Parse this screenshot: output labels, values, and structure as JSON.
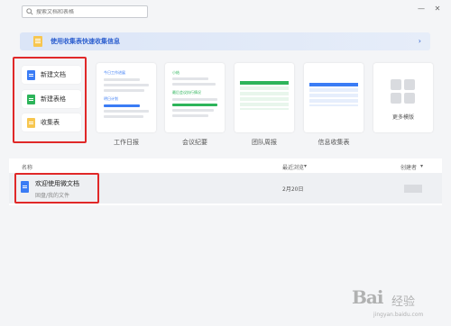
{
  "search": {
    "placeholder": "搜索文档和表格",
    "icon": "search-icon"
  },
  "window": {
    "minimize": "—",
    "close": "✕"
  },
  "banner": {
    "text": "使用收集表快速收集信息",
    "icon": "form-icon",
    "arrow": "›"
  },
  "new_buttons": [
    {
      "label": "新建文档",
      "icon": "doc-icon",
      "color": "#3a7cf5"
    },
    {
      "label": "新建表格",
      "icon": "sheet-icon",
      "color": "#2db45a"
    },
    {
      "label": "收集表",
      "icon": "form-icon",
      "color": "#f7c64f"
    }
  ],
  "templates": [
    {
      "label": "工作日报",
      "preview_heading": "今日工作进展",
      "preview_sub": "明日计划"
    },
    {
      "label": "会议纪要",
      "preview_heading": "小结",
      "preview_sub": "最后会议执行情况"
    },
    {
      "label": "团队周报"
    },
    {
      "label": "信息收集表"
    },
    {
      "label": "更多模版"
    }
  ],
  "list": {
    "col_name": "名称",
    "col_recent": "最近浏览",
    "col_creator": "创建者",
    "sort_arrow": "▾",
    "rows": [
      {
        "title": "欢迎使用微文档",
        "path": "固盘/我的文件",
        "date": "2月20日"
      }
    ]
  },
  "watermark": {
    "brand": "Bai",
    "sub": "经验",
    "url": "jingyan.baidu.com"
  },
  "colors": {
    "accent": "#2d5fcf",
    "highlight": "#e02828",
    "doc": "#3a7cf5",
    "sheet": "#2db45a",
    "form": "#f7c64f"
  }
}
